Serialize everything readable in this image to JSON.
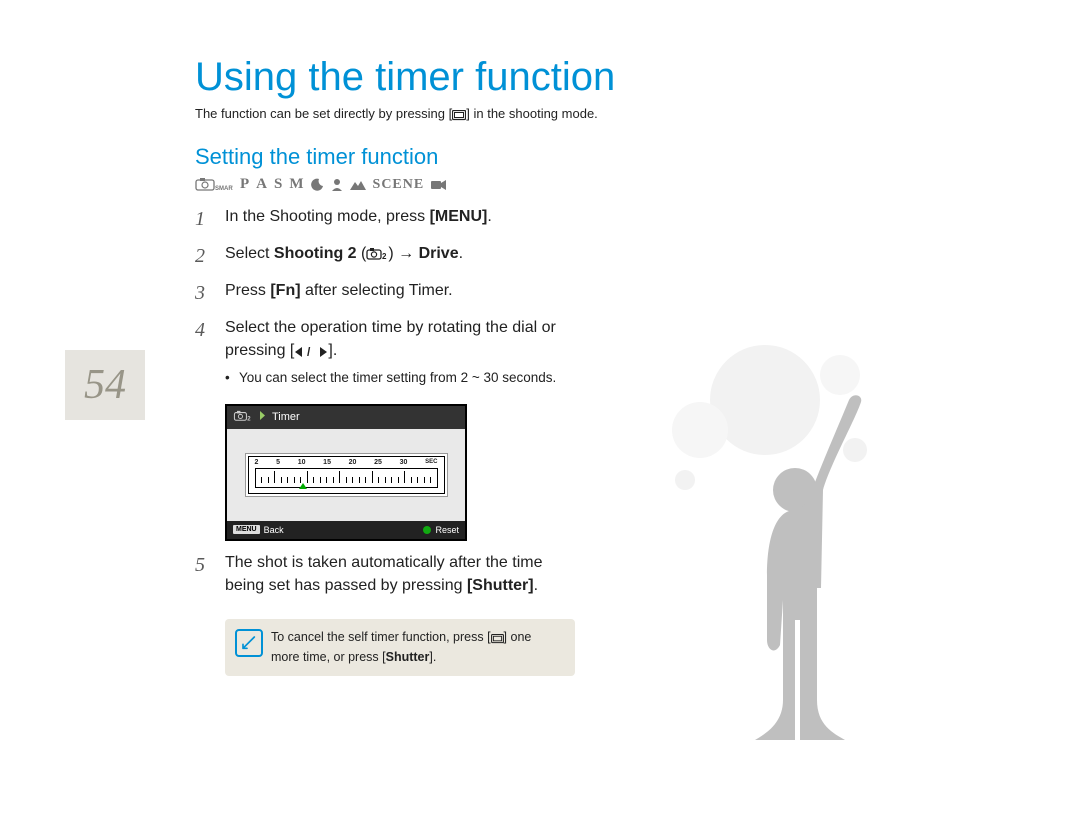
{
  "page_number": "54",
  "title": "Using the timer function",
  "intro_prefix": "The function can be set directly by pressing [",
  "intro_suffix": "] in the shooting mode.",
  "section_heading": "Setting the timer function",
  "mode_row": {
    "smart_label": "SMART",
    "letters": [
      "P",
      "A",
      "S",
      "M"
    ],
    "scene_label": "SCENE"
  },
  "steps": {
    "s1_num": "1",
    "s1_a": "In the Shooting mode, press ",
    "s1_b": "[MENU]",
    "s1_c": ".",
    "s2_num": "2",
    "s2_a": "Select ",
    "s2_b": "Shooting 2",
    "s2_c": " (",
    "s2_d": ")  → ",
    "s2_e": "Drive",
    "s2_f": ".",
    "s3_num": "3",
    "s3_a": "Press ",
    "s3_b": "[Fn]",
    "s3_c": " after selecting Timer.",
    "s4_num": "4",
    "s4_a": "Select the operation time by rotating the dial or pressing [",
    "s4_b": "].",
    "s4_bullet": "You can select the timer setting from 2 ~ 30 seconds.",
    "s5_num": "5",
    "s5_a": "The shot is taken automatically after the time being set has passed by pressing ",
    "s5_b": "[Shutter]",
    "s5_c": "."
  },
  "camera_screen": {
    "header_label": "Timer",
    "ruler_labels": [
      "2",
      "5",
      "10",
      "15",
      "20",
      "25",
      "30",
      "SEC"
    ],
    "footer_menu_chip": "MENU",
    "footer_back": "Back",
    "footer_reset": "Reset"
  },
  "note": {
    "prefix": "To cancel the self timer function, press [",
    "middle": "] one more time, or press [",
    "shutter": "Shutter",
    "suffix": "]."
  }
}
